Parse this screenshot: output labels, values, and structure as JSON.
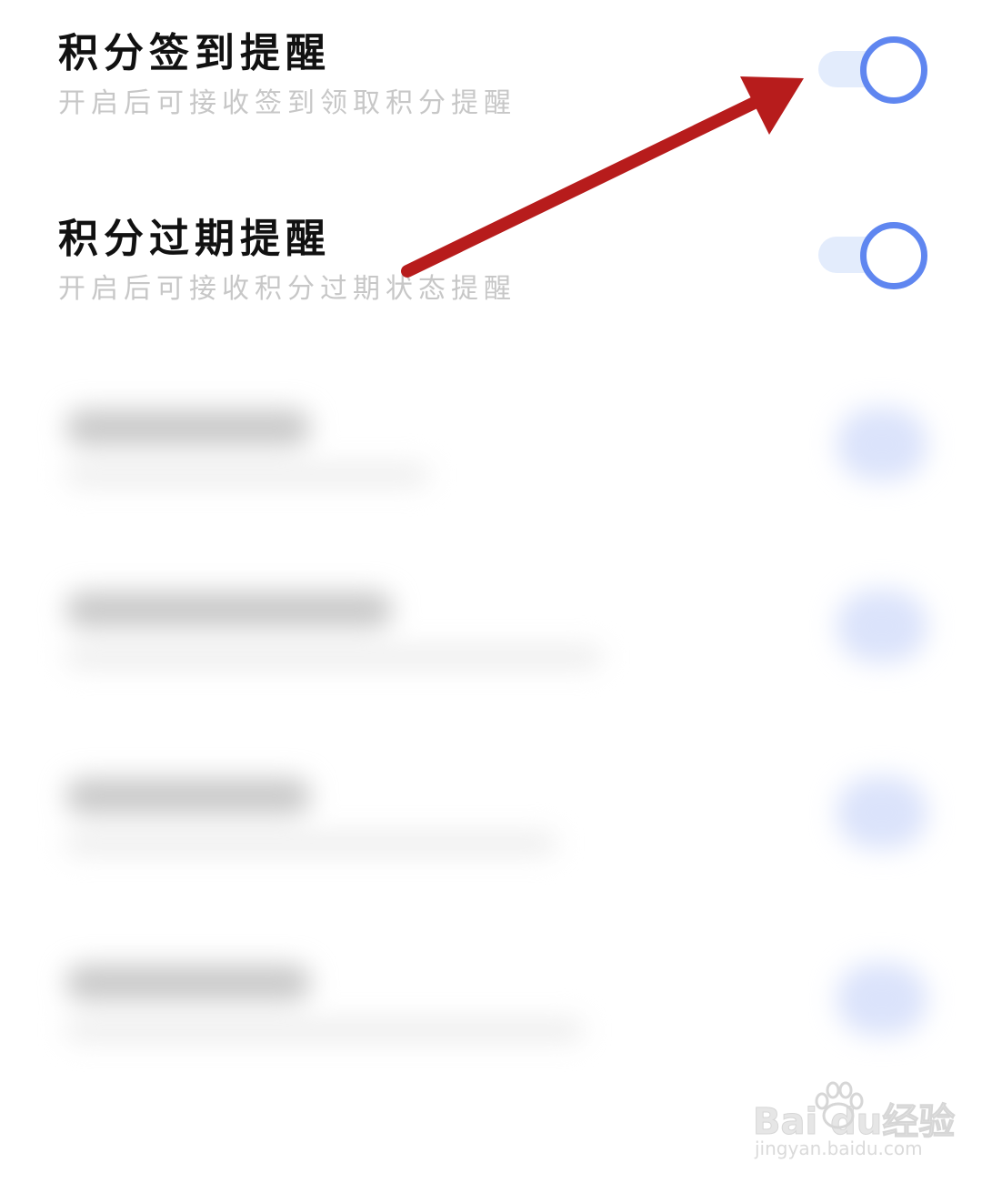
{
  "settings": [
    {
      "title": "积分签到提醒",
      "description": "开启后可接收签到领取积分提醒",
      "enabled": false
    },
    {
      "title": "积分过期提醒",
      "description": "开启后可接收积分过期状态提醒",
      "enabled": false
    }
  ],
  "colors": {
    "toggle_border": "#5f86f0",
    "toggle_track": "#e3ecfc",
    "title_text": "#111111",
    "description_text": "#c7c7c7",
    "annotation_arrow": "#b71c1c"
  },
  "watermark": {
    "brand": "Bai  du经验",
    "url": "jingyan.baidu.com",
    "icon": "paw-icon"
  }
}
